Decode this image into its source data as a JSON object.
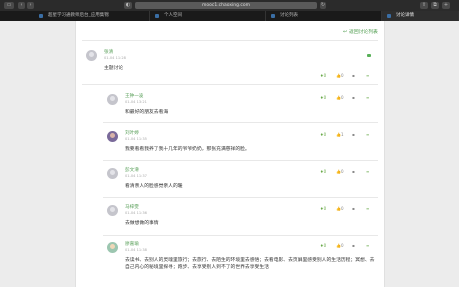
{
  "browser": {
    "url": "mooc1.chaoxing.com",
    "tabs": [
      {
        "label": "超星学习通教师后台_应用集锦"
      },
      {
        "label": "个人空间"
      },
      {
        "label": "讨论列表"
      },
      {
        "label": "讨论详情"
      }
    ]
  },
  "back_link": "返回讨论列表",
  "posts": [
    {
      "name": "张清",
      "time": "01-04 11:28",
      "text": "主题讨论",
      "like": "0",
      "praise": "0"
    },
    {
      "name": "王钟一凌",
      "time": "01-04 13:21",
      "text": "和最好的朋友去看海",
      "like": "0",
      "praise": "0"
    },
    {
      "name": "刘叶婷",
      "time": "01-04 11:35",
      "text": "我要看看我养了我十几年的爷爷奶奶，那张充满慈祥的脸。",
      "like": "0",
      "praise": "1"
    },
    {
      "name": "彭文滑",
      "time": "01-04 11:37",
      "text": "看清亲人的脸感觉亲人的暖",
      "like": "0",
      "praise": "0"
    },
    {
      "name": "马梓雯",
      "time": "01-04 11:36",
      "text": "去做想做的事情",
      "like": "0",
      "praise": "0"
    },
    {
      "name": "廖嘉瑜",
      "time": "01-04 11:38",
      "text": "去读书、去别人的灵魂里旅行；去旅行、去陌生的环境里去感悟；去看电影、去页屏里感受别人的生活历程；冥想、去自己内心的秘境里探寻；跑步、去享受别人到不了的世界去享受生活",
      "like": "0",
      "praise": "0"
    }
  ]
}
